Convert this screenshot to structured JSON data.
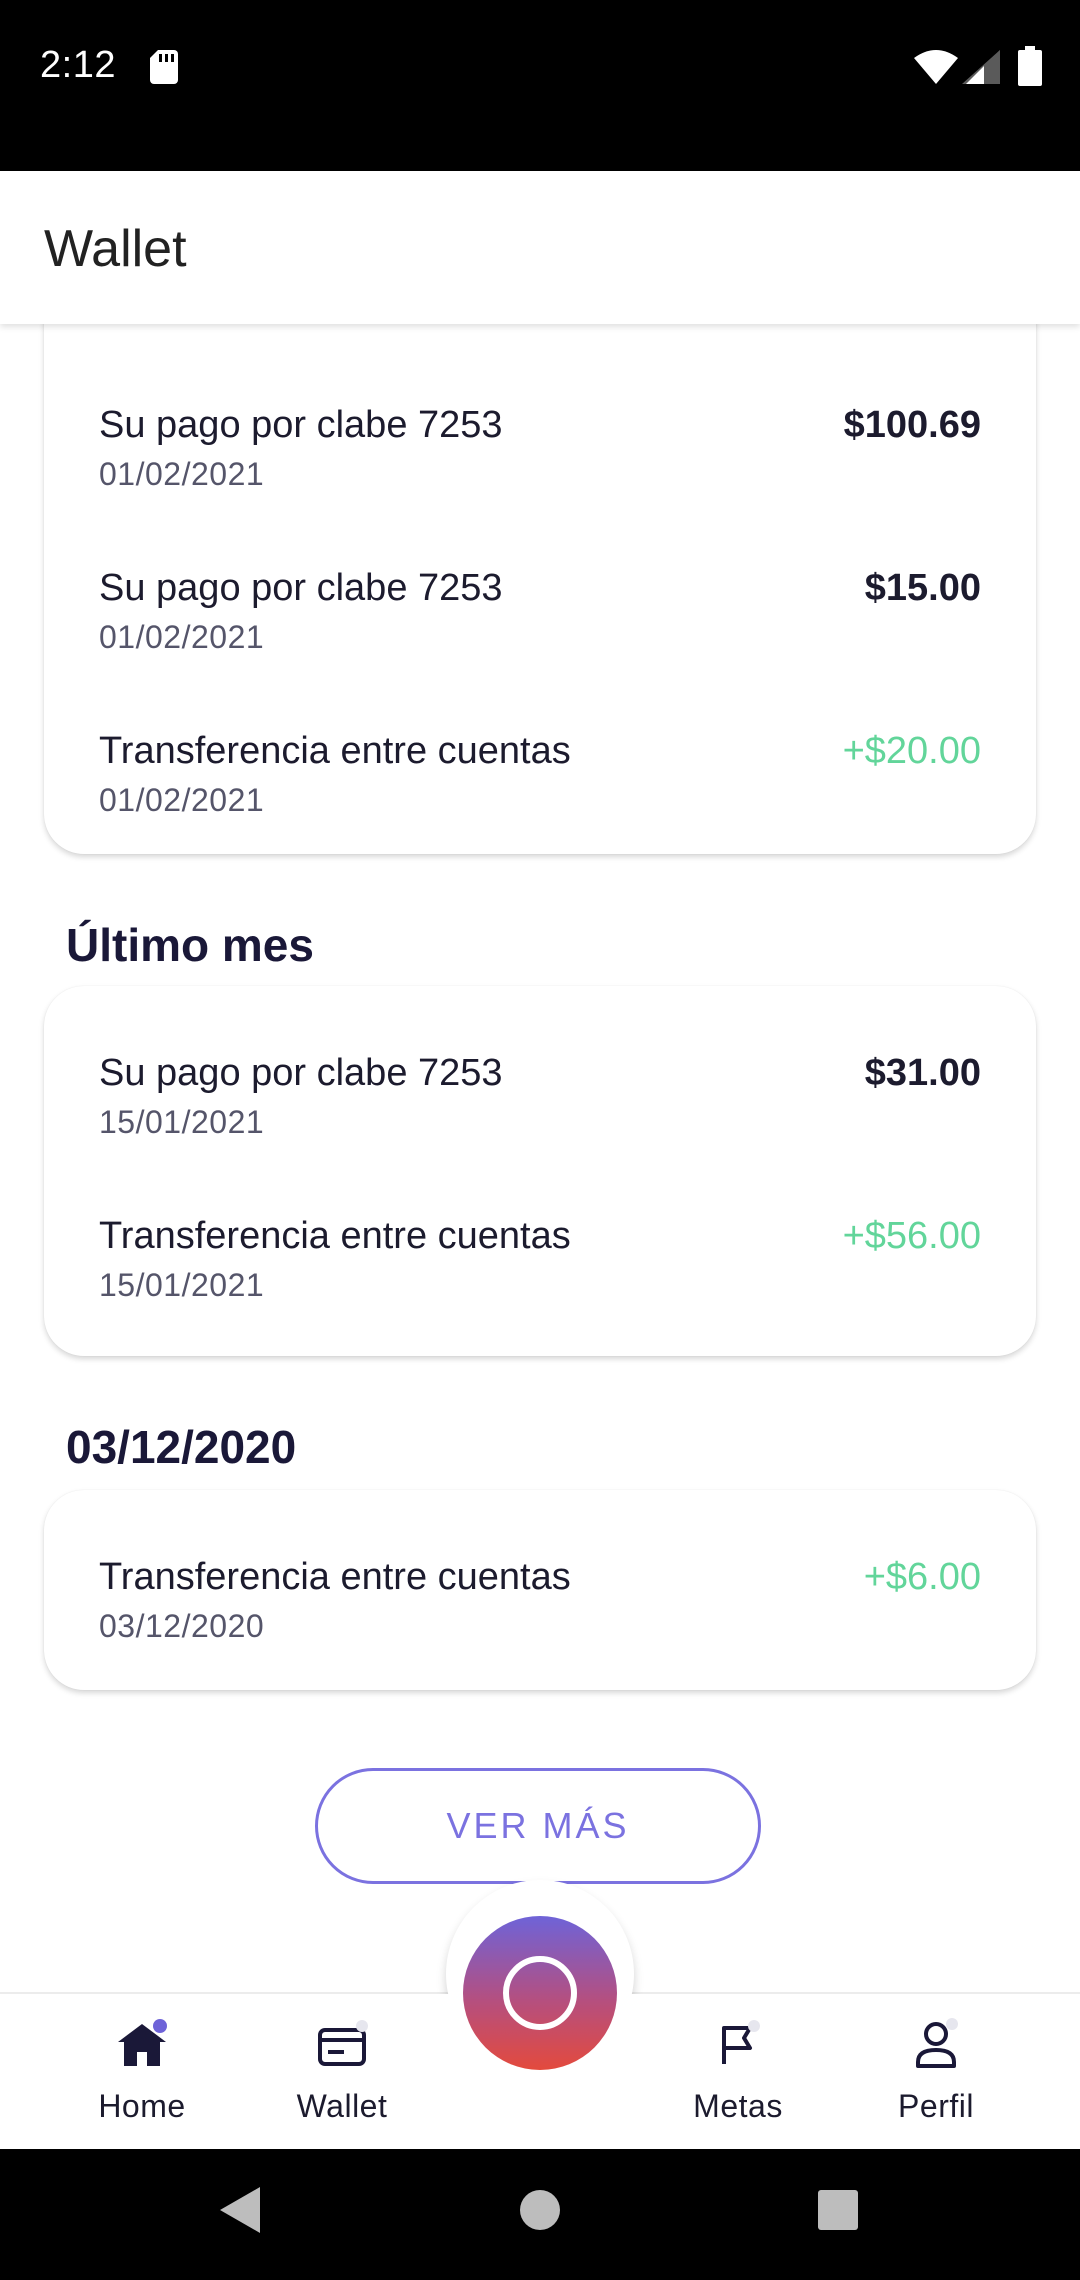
{
  "status_bar": {
    "time": "2:12"
  },
  "app_bar": {
    "title": "Wallet"
  },
  "groups": [
    {
      "heading": "",
      "transactions": [
        {
          "title": "Su pago por clabe 7253",
          "date": "01/02/2021",
          "amount": "$100.69",
          "type": "debit"
        },
        {
          "title": "Su pago por clabe 7253",
          "date": "01/02/2021",
          "amount": "$15.00",
          "type": "debit"
        },
        {
          "title": "Transferencia entre cuentas",
          "date": "01/02/2021",
          "amount": "+$20.00",
          "type": "credit"
        }
      ]
    },
    {
      "heading": "Último mes",
      "transactions": [
        {
          "title": "Su pago por clabe 7253",
          "date": "15/01/2021",
          "amount": "$31.00",
          "type": "debit"
        },
        {
          "title": "Transferencia entre cuentas",
          "date": "15/01/2021",
          "amount": "+$56.00",
          "type": "credit"
        }
      ]
    },
    {
      "heading": "03/12/2020",
      "transactions": [
        {
          "title": "Transferencia entre cuentas",
          "date": "03/12/2020",
          "amount": "+$6.00",
          "type": "credit"
        }
      ]
    }
  ],
  "more_button": {
    "label": "VER MÁS"
  },
  "bottom_nav": {
    "items": [
      {
        "label": "Home",
        "icon": "home-icon"
      },
      {
        "label": "Wallet",
        "icon": "card-icon"
      },
      {
        "label": "Metas",
        "icon": "flag-icon"
      },
      {
        "label": "Perfil",
        "icon": "person-icon"
      }
    ]
  },
  "colors": {
    "accent": "#7b72e0",
    "credit": "#62d59a",
    "heading": "#1a1838",
    "fab_top": "#6e63d8",
    "fab_bottom": "#e34a3d"
  }
}
